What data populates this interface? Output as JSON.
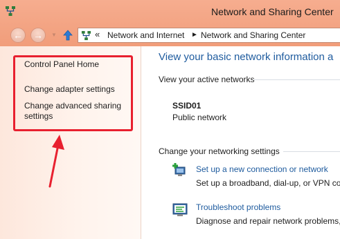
{
  "window": {
    "title": "Network and Sharing Center"
  },
  "address": {
    "overflow": "«",
    "crumbs": [
      "Network and Internet",
      "Network and Sharing Center"
    ],
    "separator": "►"
  },
  "left_pane": {
    "links": [
      "Control Panel Home",
      "Change adapter settings",
      "Change advanced sharing settings"
    ]
  },
  "main": {
    "title": "View your basic network information a",
    "active_heading": "View your active networks",
    "network": {
      "name": "SSID01",
      "type": "Public network"
    },
    "change_heading": "Change your networking settings",
    "tasks": [
      {
        "link": "Set up a new connection or network",
        "desc": "Set up a broadband, dial-up, or VPN conn",
        "icon": "new-connection-icon"
      },
      {
        "link": "Troubleshoot problems",
        "desc": "Diagnose and repair network problems, or",
        "icon": "troubleshoot-icon"
      }
    ]
  },
  "annotation": {
    "color": "#e8202f"
  }
}
